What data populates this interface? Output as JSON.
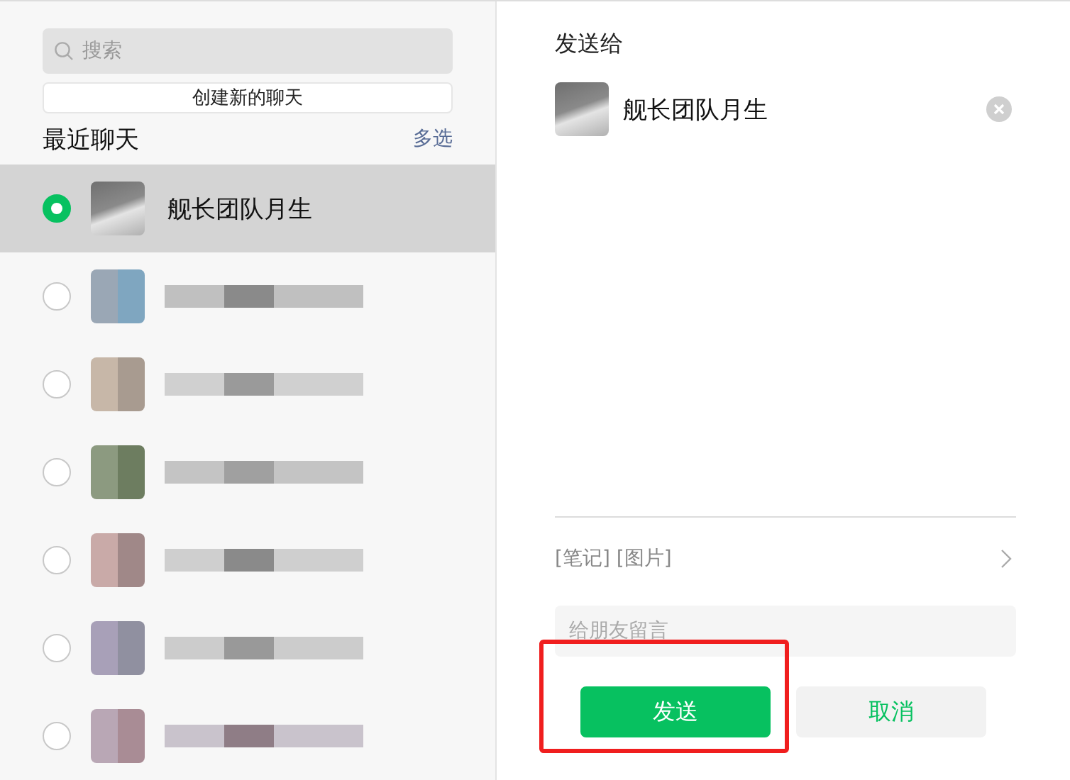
{
  "search": {
    "placeholder": "搜索"
  },
  "new_chat_button": "创建新的聊天",
  "recent": {
    "title": "最近聊天",
    "multi_select": "多选"
  },
  "contacts": [
    {
      "kind": "named",
      "name": "舰长团队月生",
      "selected": true
    },
    {
      "kind": "blurred",
      "selected": false
    },
    {
      "kind": "blurred",
      "selected": false
    },
    {
      "kind": "blurred",
      "selected": false
    },
    {
      "kind": "blurred",
      "selected": false
    },
    {
      "kind": "blurred",
      "selected": false
    },
    {
      "kind": "blurred",
      "selected": false
    }
  ],
  "send_to": {
    "title": "发送给",
    "recipients": [
      {
        "name": "舰长团队月生"
      }
    ]
  },
  "attachment": "[笔记] [图片]",
  "message": {
    "placeholder": "给朋友留言"
  },
  "buttons": {
    "send": "发送",
    "cancel": "取消"
  }
}
